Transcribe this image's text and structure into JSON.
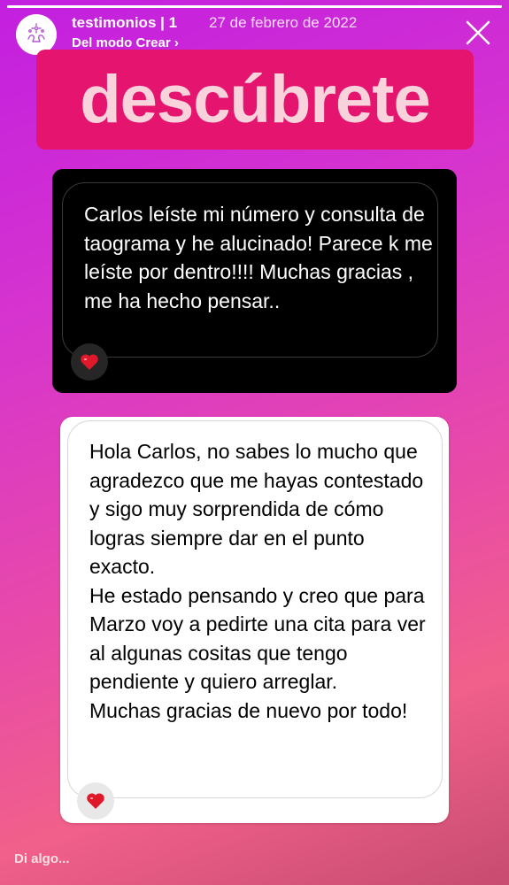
{
  "story": {
    "progress": 1.0,
    "account": "testimonios | 1",
    "date": "27 de febrero de 2022",
    "subline": "Del modo Crear ›"
  },
  "banner": {
    "text": "descúbrete"
  },
  "messages": [
    {
      "text": "Carlos leíste mi número y consulta de taograma y he alucinado! Parece k me leíste por dentro!!!! Muchas gracias , me ha hecho pensar..",
      "reaction": "heart"
    },
    {
      "paragraphs": [
        "Hola Carlos, no sabes lo mucho que agradezco que me hayas contestado y sigo muy sorprendida de cómo logras siempre dar en el punto exacto.",
        "He estado pensando y creo que para Marzo voy a pedirte una cita para ver al algunas cositas que tengo pendiente y quiero arreglar.",
        "Muchas gracias de nuevo por todo!"
      ],
      "reaction": "heart"
    }
  ],
  "reply": {
    "placeholder": "Di algo..."
  },
  "icons": {
    "avatar": "hands-sparkles-icon",
    "close": "close-icon",
    "reaction": "heart-icon"
  },
  "colors": {
    "banner_bg": "#e5156f",
    "banner_text": "#f9d3db",
    "heart": "#e0192a"
  }
}
